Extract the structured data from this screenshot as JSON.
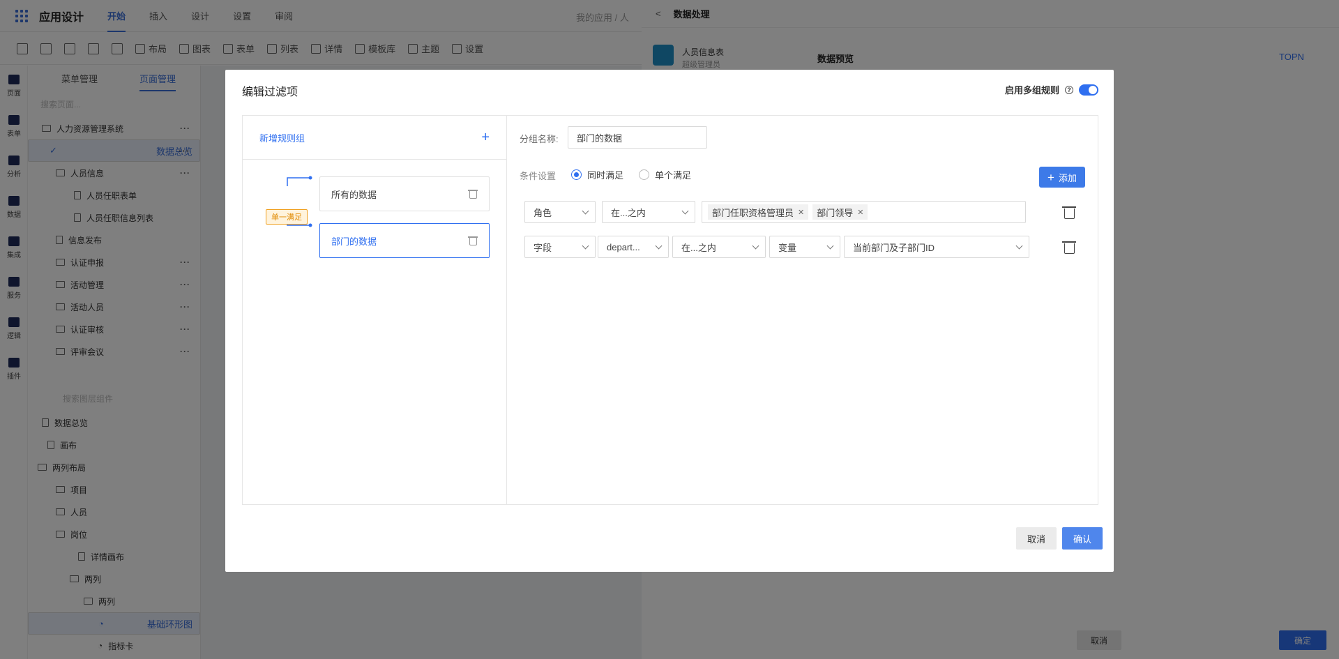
{
  "topbar": {
    "app_title": "应用设计",
    "tabs": [
      "开始",
      "插入",
      "设计",
      "设置",
      "审阅"
    ],
    "breadcrumb": "我的应用 / 人"
  },
  "toolbar": {
    "items": [
      "布局",
      "图表",
      "表单",
      "列表",
      "详情",
      "模板库",
      "主题",
      "设置"
    ]
  },
  "rail": {
    "items": [
      "页面",
      "表单",
      "分析",
      "数据",
      "集成",
      "服务",
      "逻辑",
      "插件"
    ]
  },
  "left_panel": {
    "tabs": [
      "菜单管理",
      "页面管理"
    ],
    "search_placeholder": "搜索页面...",
    "tree": [
      "人力资源管理系统",
      "数据总览",
      "人员信息",
      "人员任职表单",
      "人员任职信息列表",
      "信息发布",
      "认证申报",
      "活动管理",
      "活动人员",
      "认证审核",
      "评审会议"
    ],
    "component_search_placeholder": "搜索图层组件",
    "layers": [
      "数据总览",
      "画布",
      "两列布局",
      "项目",
      "人员",
      "岗位",
      "详情画布",
      "两列",
      "两列",
      "基础环形图",
      "指标卡"
    ]
  },
  "drawer": {
    "back_icon": "chevron-left-icon",
    "title": "数据处理",
    "source_name": "人员信息表",
    "source_role": "超级管理员",
    "preview_title": "数据预览",
    "topn_label": "TOPN",
    "cancel_label": "取消",
    "confirm_label": "确定"
  },
  "modal": {
    "title": "编辑过滤项",
    "multi_rule_label": "启用多组规则",
    "multi_rule_enabled": true,
    "new_group_label": "新增规则组",
    "groups": [
      {
        "name": "所有的数据"
      },
      {
        "name": "部门的数据"
      }
    ],
    "connector_badge": "单一满足",
    "group_name_label": "分组名称:",
    "group_name_value": "部门的数据",
    "condition_label": "条件设置",
    "radio_all": "同时满足",
    "radio_any": "单个满足",
    "add_label": "添加",
    "condition_rows": [
      {
        "field": "角色",
        "operator": "在...之内",
        "tags": [
          "部门任职资格管理员",
          "部门领导"
        ]
      },
      {
        "field": "字段",
        "subfield": "depart...",
        "operator": "在...之内",
        "value_type": "变量",
        "value": "当前部门及子部门ID"
      }
    ],
    "cancel_label": "取消",
    "ok_label": "确认"
  },
  "colors": {
    "primary": "#2f6ff0",
    "badge_orange": "#f0a020"
  }
}
